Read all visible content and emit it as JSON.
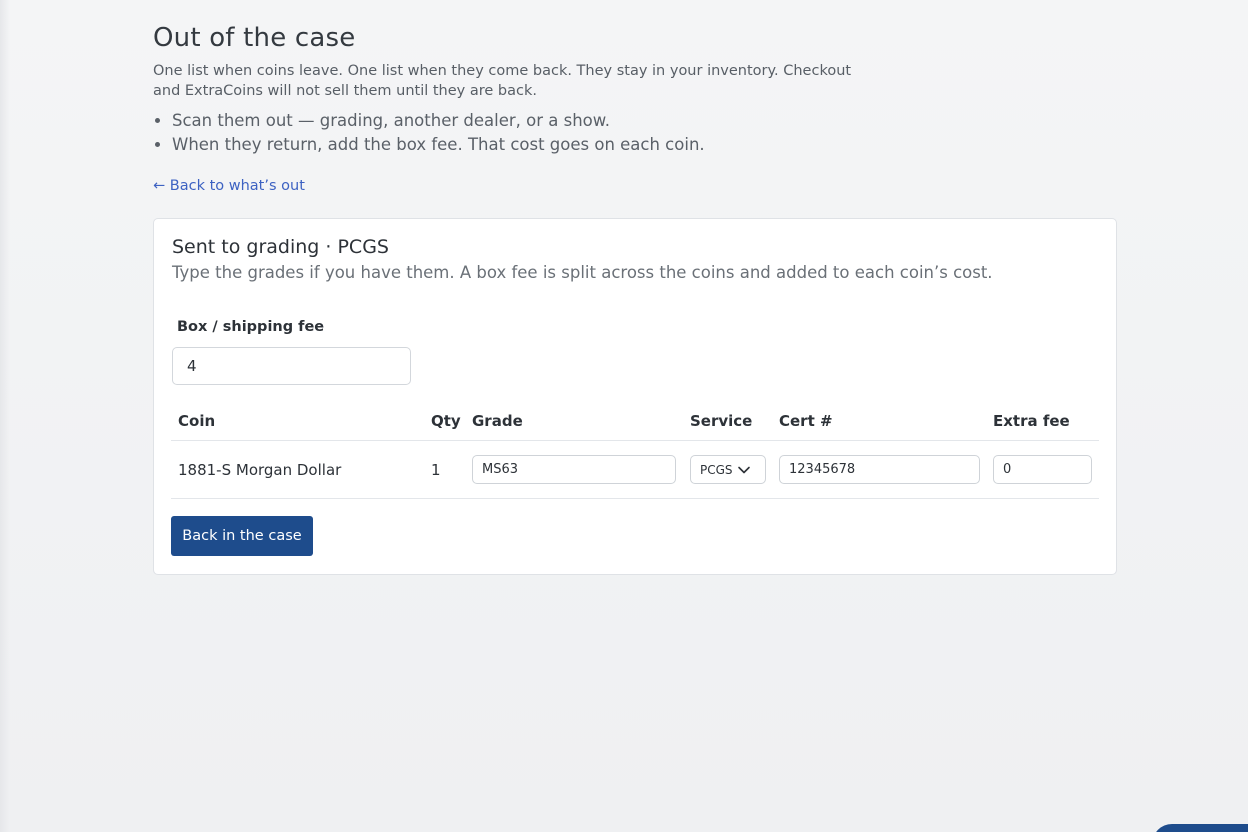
{
  "page": {
    "title": "Out of the case",
    "intro": "One list when coins leave. One list when they come back. They stay in your inventory. Checkout and ExtraCoins will not sell them until they are back.",
    "bullets": [
      "Scan them out — grading, another dealer, or a show.",
      "When they return, add the box fee. That cost goes on each coin."
    ],
    "back_link": "← Back to what’s out"
  },
  "card": {
    "title": "Sent to grading · PCGS",
    "subtitle": "Type the grades if you have them. A box fee is split across the coins and added to each coin’s cost.",
    "fee_label": "Box / shipping fee",
    "fee_value": "4",
    "table": {
      "headers": {
        "coin": "Coin",
        "qty": "Qty",
        "grade": "Grade",
        "service": "Service",
        "cert": "Cert #",
        "extra_fee": "Extra fee"
      },
      "rows": [
        {
          "coin": "1881-S Morgan Dollar",
          "qty": "1",
          "grade": "MS63",
          "service": "PCGS",
          "cert": "12345678",
          "extra_fee": "0"
        }
      ]
    },
    "submit_label": "Back in the case"
  },
  "colors": {
    "accent": "#1e4c8c",
    "link": "#3d62c2"
  },
  "icons": {
    "service_dropdown": "chevron-down-icon"
  }
}
